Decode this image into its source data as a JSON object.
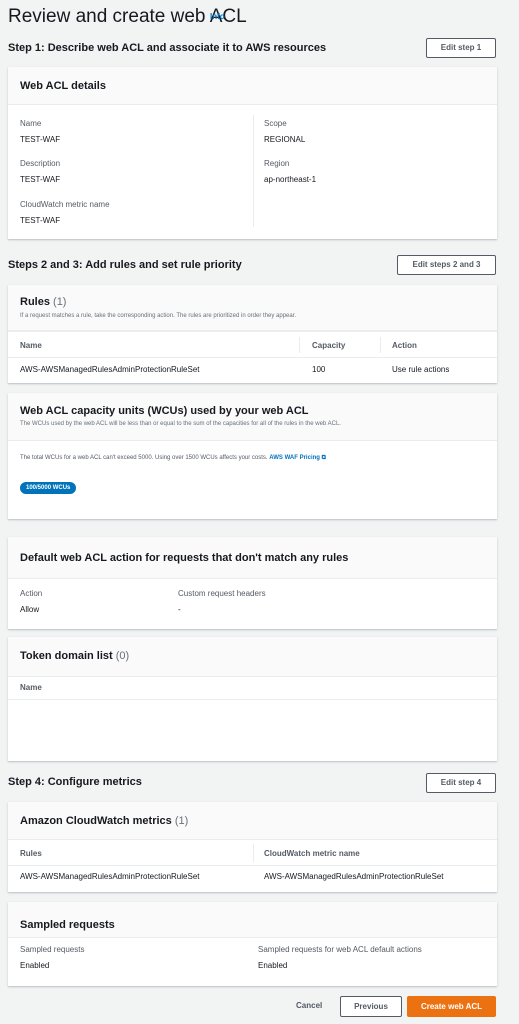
{
  "page": {
    "title": "Review and create web ACL",
    "info": "Info"
  },
  "step1": {
    "title": "Step 1: Describe web ACL and associate it to AWS resources",
    "edit_button": "Edit step 1",
    "card_title": "Web ACL details",
    "fields": {
      "name_label": "Name",
      "name_value": "TEST-WAF",
      "description_label": "Description",
      "description_value": "TEST-WAF",
      "metric_label": "CloudWatch metric name",
      "metric_value": "TEST-WAF",
      "scope_label": "Scope",
      "scope_value": "REGIONAL",
      "region_label": "Region",
      "region_value": "ap-northeast-1"
    }
  },
  "step23": {
    "title": "Steps 2 and 3: Add rules and set rule priority",
    "edit_button": "Edit steps 2 and 3",
    "rules": {
      "title": "Rules",
      "count": "(1)",
      "description": "If a request matches a rule, take the corresponding action. The rules are prioritized in order they appear.",
      "columns": [
        "Name",
        "Capacity",
        "Action"
      ],
      "rows": [
        [
          "AWS-AWSManagedRulesAdminProtectionRuleSet",
          "100",
          "Use rule actions"
        ]
      ]
    },
    "wcu": {
      "title": "Web ACL capacity units (WCUs) used by your web ACL",
      "description": "The WCUs used by the web ACL will be less than or equal to the sum of the capacities for all of the rules in the web ACL.",
      "note": "The total WCUs for a web ACL can't exceed 5000. Using over 1500 WCUs affects your costs.",
      "pricing_link": "AWS WAF Pricing",
      "badge": "100/5000 WCUs"
    },
    "default_action": {
      "title": "Default web ACL action for requests that don't match any rules",
      "action_label": "Action",
      "action_value": "Allow",
      "headers_label": "Custom request headers",
      "headers_value": "-"
    },
    "token_domains": {
      "title": "Token domain list",
      "count": "(0)",
      "column": "Name"
    }
  },
  "step4": {
    "title": "Step 4: Configure metrics",
    "edit_button": "Edit step 4",
    "metrics": {
      "title": "Amazon CloudWatch metrics",
      "count": "(1)",
      "columns": [
        "Rules",
        "CloudWatch metric name"
      ],
      "rows": [
        [
          "AWS-AWSManagedRulesAdminProtectionRuleSet",
          "AWS-AWSManagedRulesAdminProtectionRuleSet"
        ]
      ]
    },
    "sampled": {
      "title": "Sampled requests",
      "label1": "Sampled requests",
      "value1": "Enabled",
      "label2": "Sampled requests for web ACL default actions",
      "value2": "Enabled"
    }
  },
  "footer": {
    "cancel": "Cancel",
    "previous": "Previous",
    "create": "Create web ACL"
  },
  "colors": {
    "accent": "#0073bb",
    "primary_button": "#ec7211",
    "background": "#f2f3f3"
  }
}
